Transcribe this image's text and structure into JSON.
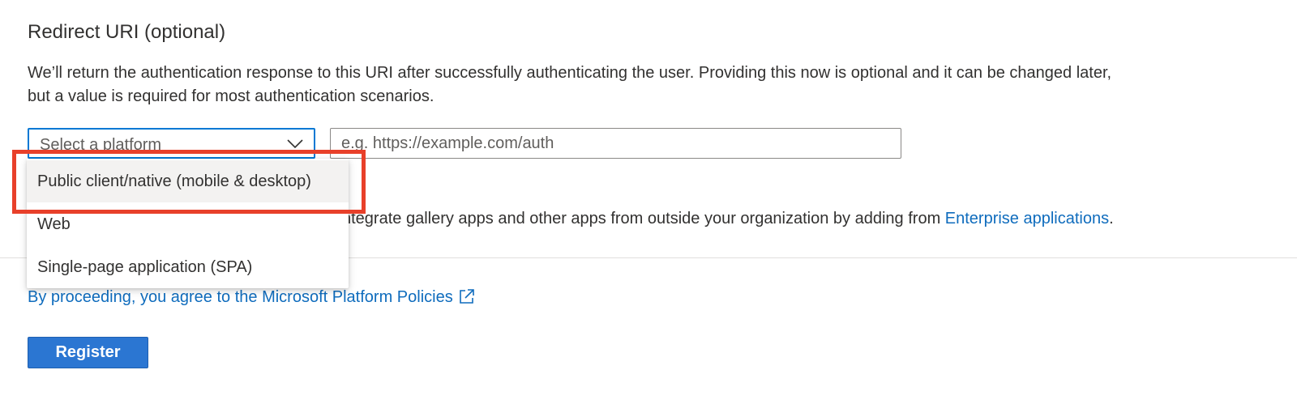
{
  "section": {
    "title": "Redirect URI (optional)",
    "description": "We’ll return the authentication response to this URI after successfully authenticating the user. Providing this now is optional and it can be changed later, but a value is required for most authentication scenarios."
  },
  "platform_select": {
    "placeholder": "Select a platform",
    "expanded": true,
    "options": [
      "Public client/native (mobile & desktop)",
      "Web",
      "Single-page application (SPA)"
    ],
    "hovered_option": "Public client/native (mobile & desktop)"
  },
  "uri_input": {
    "value": "",
    "placeholder": "e.g. https://example.com/auth"
  },
  "enterprise_note": {
    "visible_text": "ntegrate gallery apps and other apps from outside your organization by adding from ",
    "link": "Enterprise applications",
    "trailing": "."
  },
  "footer": {
    "policy_link": "By proceeding, you agree to the Microsoft Platform Policies",
    "register_label": "Register"
  },
  "annotation": {
    "highlight_color": "#e8402a"
  },
  "colors": {
    "accent": "#0078d4",
    "link": "#0f6cbd",
    "button": "#2b76d2"
  }
}
